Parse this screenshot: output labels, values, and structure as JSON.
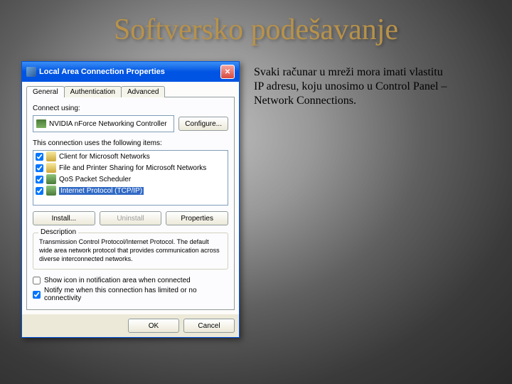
{
  "slide": {
    "title": "Softversko podešavanje"
  },
  "paragraph": "Svaki računar u mreži mora imati vlastitu IP adresu, koju unosimo u Control Panel – Network Connections.",
  "dialog": {
    "title": "Local Area Connection Properties",
    "tabs": {
      "general": "General",
      "auth": "Authentication",
      "advanced": "Advanced"
    },
    "connect_label": "Connect using:",
    "adapter": "NVIDIA nForce Networking Controller",
    "configure": "Configure...",
    "items_label": "This connection uses the following items:",
    "items": [
      {
        "label": "Client for Microsoft Networks"
      },
      {
        "label": "File and Printer Sharing for Microsoft Networks"
      },
      {
        "label": "QoS Packet Scheduler"
      },
      {
        "label": "Internet Protocol (TCP/IP)"
      }
    ],
    "install": "Install...",
    "uninstall": "Uninstall",
    "properties": "Properties",
    "desc_title": "Description",
    "desc_text": "Transmission Control Protocol/Internet Protocol. The default wide area network protocol that provides communication across diverse interconnected networks.",
    "chk_notify_area": "Show icon in notification area when connected",
    "chk_notify_limited": "Notify me when this connection has limited or no connectivity",
    "ok": "OK",
    "cancel": "Cancel"
  }
}
